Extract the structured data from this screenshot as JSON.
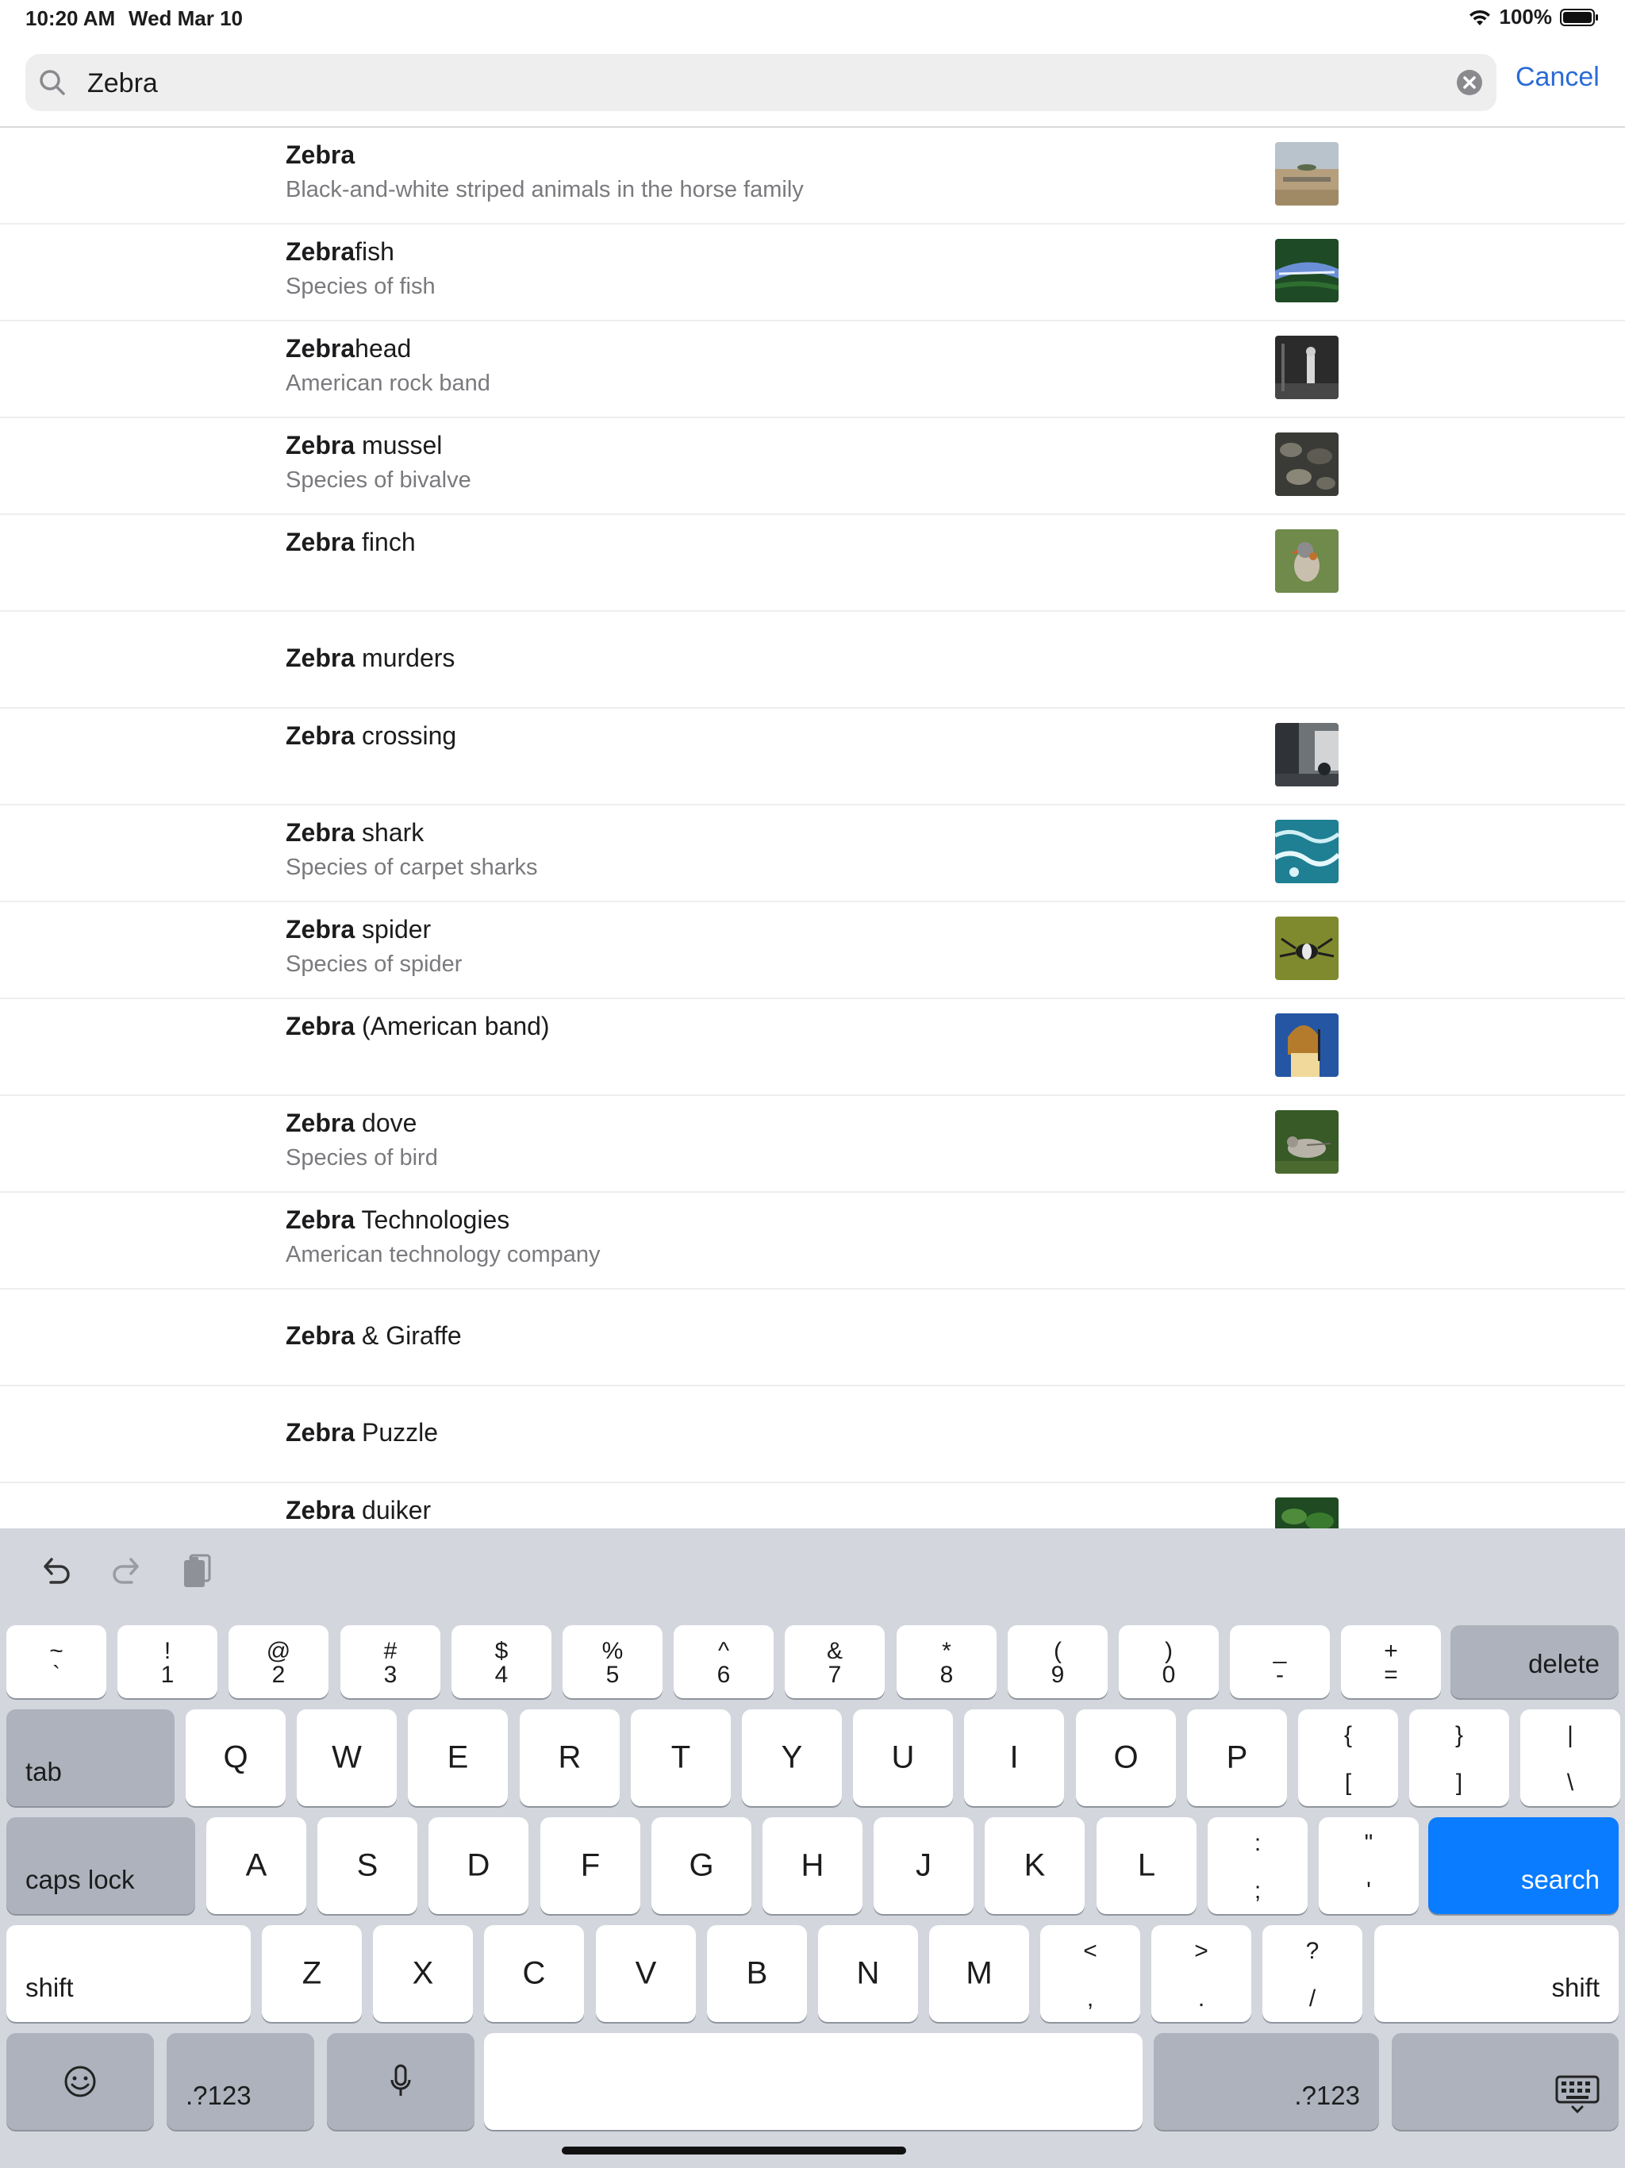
{
  "status_bar": {
    "time": "10:20 AM",
    "date": "Wed Mar 10",
    "battery": "100%"
  },
  "search": {
    "value": "Zebra",
    "cancel_label": "Cancel"
  },
  "results": [
    {
      "bold": "Zebra",
      "rest": "",
      "subtitle": "Black-and-white striped animals in the horse family",
      "thumb": "savanna"
    },
    {
      "bold": "Zebra",
      "rest": "fish",
      "subtitle": "Species of fish",
      "thumb": "fish"
    },
    {
      "bold": "Zebra",
      "rest": "head",
      "subtitle": "American rock band",
      "thumb": "concert"
    },
    {
      "bold": "Zebra",
      "rest": " mussel",
      "subtitle": "Species of bivalve",
      "thumb": "mussel"
    },
    {
      "bold": "Zebra",
      "rest": " finch",
      "subtitle": "",
      "thumb": "finch"
    },
    {
      "bold": "Zebra",
      "rest": " murders",
      "subtitle": "",
      "thumb": ""
    },
    {
      "bold": "Zebra",
      "rest": " crossing",
      "subtitle": "",
      "thumb": "street"
    },
    {
      "bold": "Zebra",
      "rest": " shark",
      "subtitle": "Species of carpet sharks",
      "thumb": "water"
    },
    {
      "bold": "Zebra",
      "rest": " spider",
      "subtitle": "Species of spider",
      "thumb": "spider"
    },
    {
      "bold": "Zebra",
      "rest": " (American band)",
      "subtitle": "",
      "thumb": "singer"
    },
    {
      "bold": "Zebra",
      "rest": " dove",
      "subtitle": "Species of bird",
      "thumb": "dove"
    },
    {
      "bold": "Zebra",
      "rest": " Technologies",
      "subtitle": "American technology company",
      "thumb": ""
    },
    {
      "bold": "Zebra",
      "rest": " & Giraffe",
      "subtitle": "",
      "thumb": ""
    },
    {
      "bold": "Zebra",
      "rest": " Puzzle",
      "subtitle": "",
      "thumb": ""
    },
    {
      "bold": "Zebra",
      "rest": " duiker",
      "subtitle": "",
      "thumb": "foliage"
    }
  ],
  "keyboard": {
    "row1": [
      [
        "~",
        "`"
      ],
      [
        "!",
        "1"
      ],
      [
        "@",
        "2"
      ],
      [
        "#",
        "3"
      ],
      [
        "$",
        "4"
      ],
      [
        "%",
        "5"
      ],
      [
        "^",
        "6"
      ],
      [
        "&",
        "7"
      ],
      [
        "*",
        "8"
      ],
      [
        "(",
        "9"
      ],
      [
        ")",
        "0"
      ],
      [
        "_",
        "-"
      ],
      [
        "+",
        "="
      ]
    ],
    "delete_label": "delete",
    "tab_label": "tab",
    "row2": [
      "Q",
      "W",
      "E",
      "R",
      "T",
      "Y",
      "U",
      "I",
      "O",
      "P"
    ],
    "row2_symbols": [
      [
        "{",
        "["
      ],
      [
        "}",
        "]"
      ],
      [
        "|",
        "\\"
      ]
    ],
    "caps_label": "caps lock",
    "row3": [
      "A",
      "S",
      "D",
      "F",
      "G",
      "H",
      "J",
      "K",
      "L"
    ],
    "row3_symbols": [
      [
        ":",
        ";"
      ],
      [
        "\"",
        "'"
      ]
    ],
    "search_label": "search",
    "shift_label": "shift",
    "row4": [
      "Z",
      "X",
      "C",
      "V",
      "B",
      "N",
      "M"
    ],
    "row4_symbols": [
      [
        "<",
        ","
      ],
      [
        ">",
        "."
      ],
      [
        "?",
        "/"
      ]
    ],
    "numbers_label": ".?123"
  },
  "colors": {
    "accent": "#0a7cff",
    "link": "#2a6bd6"
  }
}
